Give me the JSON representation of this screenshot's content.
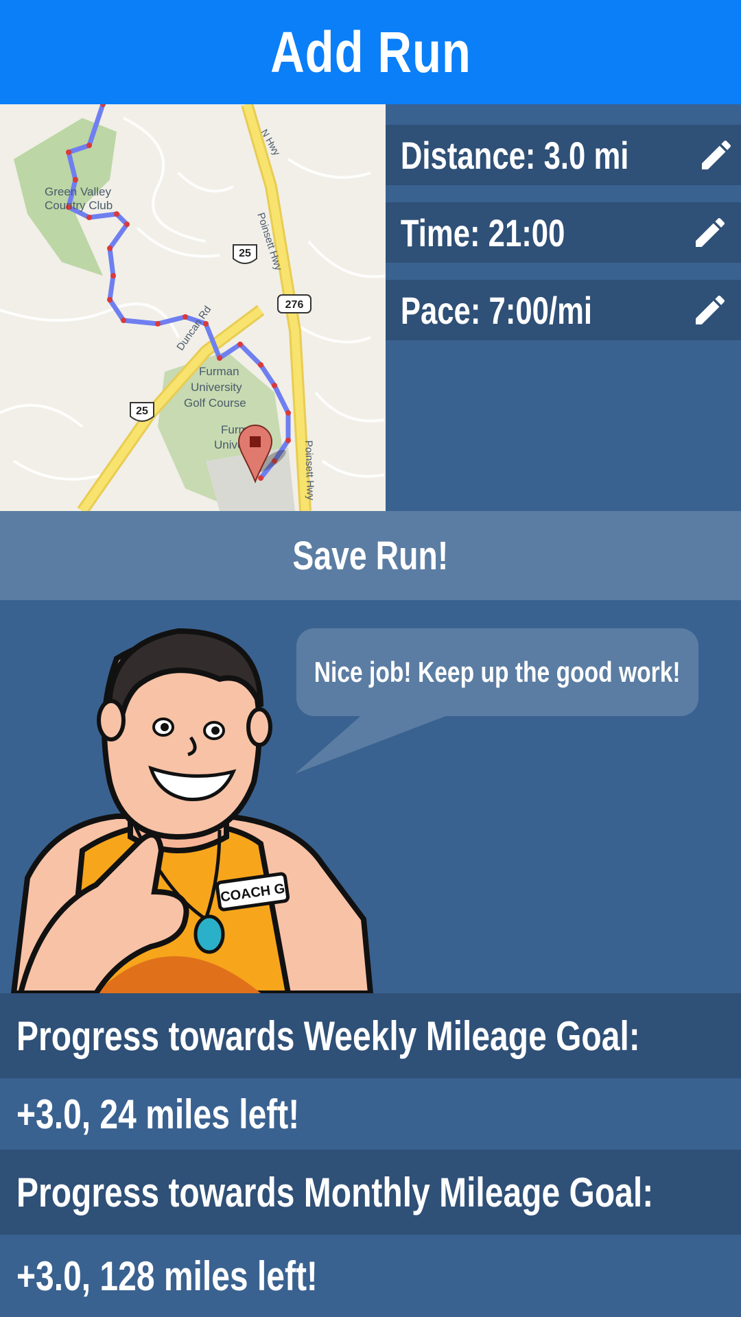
{
  "header": {
    "title": "Add Run"
  },
  "map": {
    "labels": {
      "club_1": "Green Valley",
      "club_2": "Country Club",
      "road_n": "N Hwy",
      "poinsett": "Poinsett Hwy",
      "poinsett_2": "Poinsett Hwy",
      "duncan": "Duncan Rd",
      "route_25": "25",
      "route_25_b": "25",
      "route_276": "276",
      "golf_1": "Furman",
      "golf_2": "University",
      "golf_3": "Golf Course",
      "univ_1": "Furman",
      "univ_2": "University"
    },
    "route_color": "#6f7ff0",
    "marker_color": "#d93a3a"
  },
  "stats": {
    "distance": "Distance: 3.0 mi",
    "time": "Time: 21:00",
    "pace": "Pace: 7:00/mi",
    "edit_icon": "pencil-icon"
  },
  "save": {
    "label": "Save Run!"
  },
  "coach": {
    "message": "Nice job! Keep up the good work!",
    "badge": "COACH G"
  },
  "progress": {
    "weekly_title": "Progress towards Weekly Mileage Goal:",
    "weekly_value": "+3.0, 24 miles left!",
    "monthly_title": "Progress towards Monthly Mileage Goal:",
    "monthly_value": "+3.0, 128 miles left!"
  },
  "colors": {
    "header": "#0a7ff8",
    "background": "#3a6290",
    "row_dark": "#2f5077",
    "button": "#5b7da3"
  }
}
